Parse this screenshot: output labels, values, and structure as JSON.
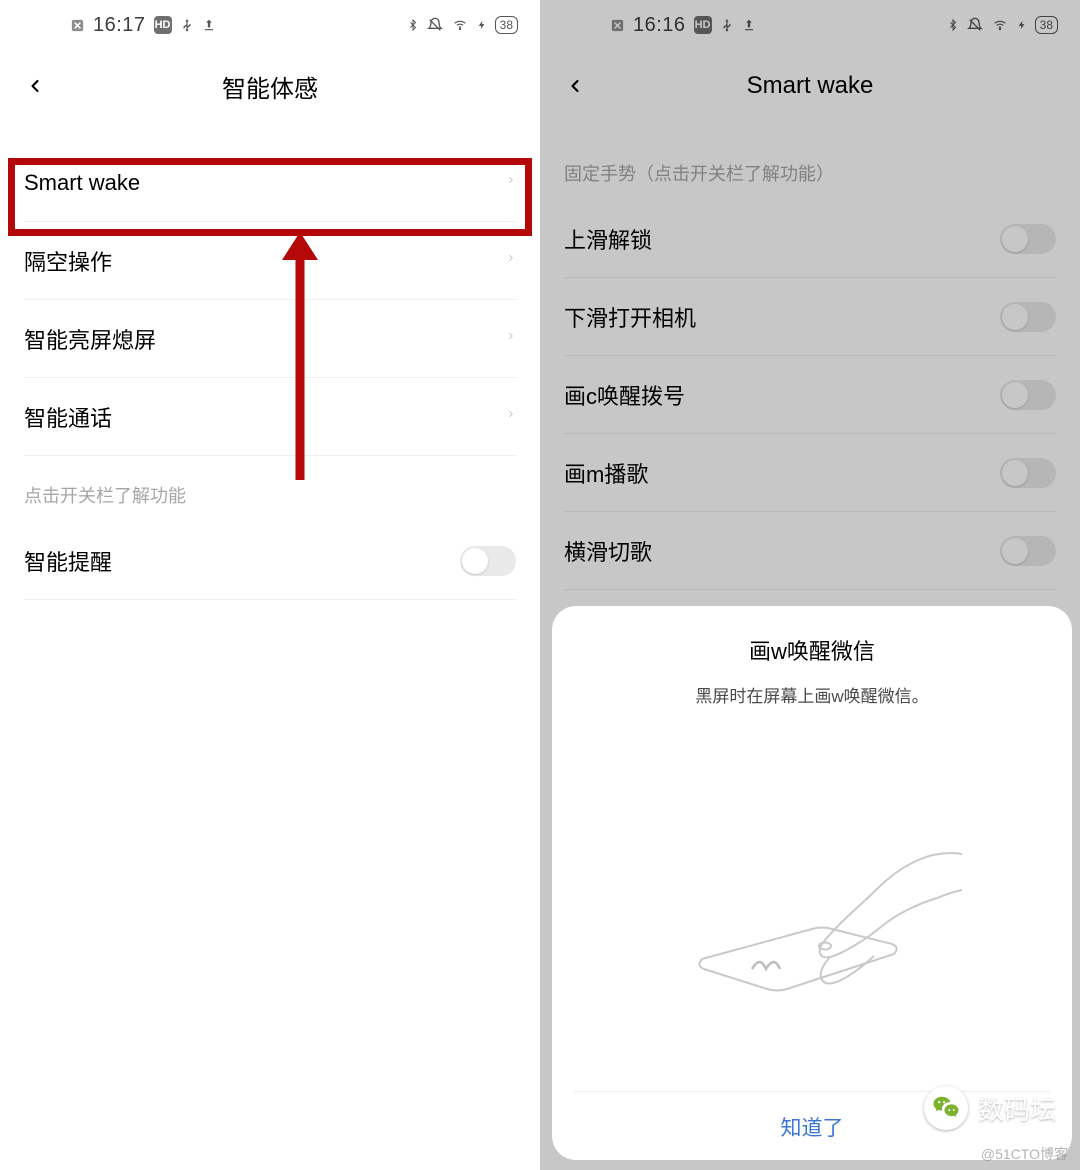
{
  "left": {
    "status": {
      "time": "16:17",
      "battery": "38"
    },
    "title": "智能体感",
    "items": [
      {
        "label": "Smart wake"
      },
      {
        "label": "隔空操作"
      },
      {
        "label": "智能亮屏熄屏"
      },
      {
        "label": "智能通话"
      }
    ],
    "section_label": "点击开关栏了解功能",
    "toggle_item": {
      "label": "智能提醒"
    }
  },
  "right": {
    "status": {
      "time": "16:16",
      "battery": "38"
    },
    "title": "Smart wake",
    "section_label": "固定手势（点击开关栏了解功能）",
    "items": [
      {
        "label": "上滑解锁"
      },
      {
        "label": "下滑打开相机"
      },
      {
        "label": "画c唤醒拨号"
      },
      {
        "label": "画m播歌"
      },
      {
        "label": "横滑切歌"
      }
    ],
    "popup": {
      "title": "画w唤醒微信",
      "desc": "黑屏时在屏幕上画w唤醒微信。",
      "action": "知道了"
    }
  },
  "brand": "数码坛",
  "watermark": "@51CTO博客"
}
